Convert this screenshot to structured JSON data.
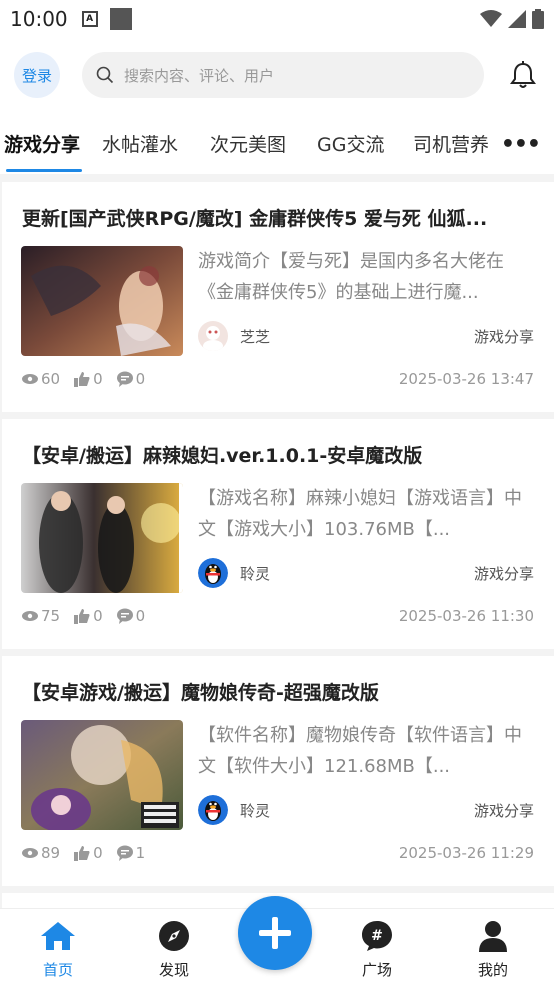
{
  "status_bar": {
    "time": "10:00",
    "notif_icon": "A"
  },
  "header": {
    "login_label": "登录",
    "search_placeholder": "搜索内容、评论、用户"
  },
  "tabs": [
    {
      "label": "游戏分享",
      "active": true
    },
    {
      "label": "水帖灌水"
    },
    {
      "label": "次元美图"
    },
    {
      "label": "GG交流"
    },
    {
      "label": "司机营养"
    }
  ],
  "posts": [
    {
      "title": "更新[国产武侠RPG/魔改] 金庸群侠传5 爱与死 仙狐...",
      "excerpt": "游戏简介【爱与死】是国内多名大佬在《金庸群侠传5》的基础上进行魔...",
      "author": "芝芝",
      "category": "游戏分享",
      "views": "60",
      "likes": "0",
      "comments": "0",
      "date": "2025-03-26 13:47",
      "thumb_colors": [
        "#3a2a2a",
        "#c9784a",
        "#f2d2b4"
      ]
    },
    {
      "title": "【安卓/搬运】麻辣媳妇.ver.1.0.1-安卓魔改版",
      "excerpt": "【游戏名称】麻辣小媳妇【游戏语言】中文【游戏大小】103.76MB【...",
      "author": "聆灵",
      "category": "游戏分享",
      "views": "75",
      "likes": "0",
      "comments": "0",
      "date": "2025-03-26 11:30",
      "thumb_colors": [
        "#2b2b2b",
        "#8a6a3a",
        "#e8c05a"
      ]
    },
    {
      "title": "【安卓游戏/搬运】魔物娘传奇-超强魔改版",
      "excerpt": "【软件名称】魔物娘传奇【软件语言】中文【软件大小】121.68MB【...",
      "author": "聆灵",
      "category": "游戏分享",
      "views": "89",
      "likes": "0",
      "comments": "1",
      "date": "2025-03-26 11:29",
      "thumb_colors": [
        "#4a3a5a",
        "#9a7ab0",
        "#e0c8a8"
      ]
    }
  ],
  "bottom_nav": [
    {
      "label": "首页",
      "icon": "home-icon",
      "active": true
    },
    {
      "label": "发现",
      "icon": "compass-icon"
    },
    {
      "label": "广场",
      "icon": "hashtag-icon"
    },
    {
      "label": "我的",
      "icon": "user-icon"
    }
  ],
  "colors": {
    "accent": "#1e88e5",
    "background": "#f3f3f3"
  }
}
